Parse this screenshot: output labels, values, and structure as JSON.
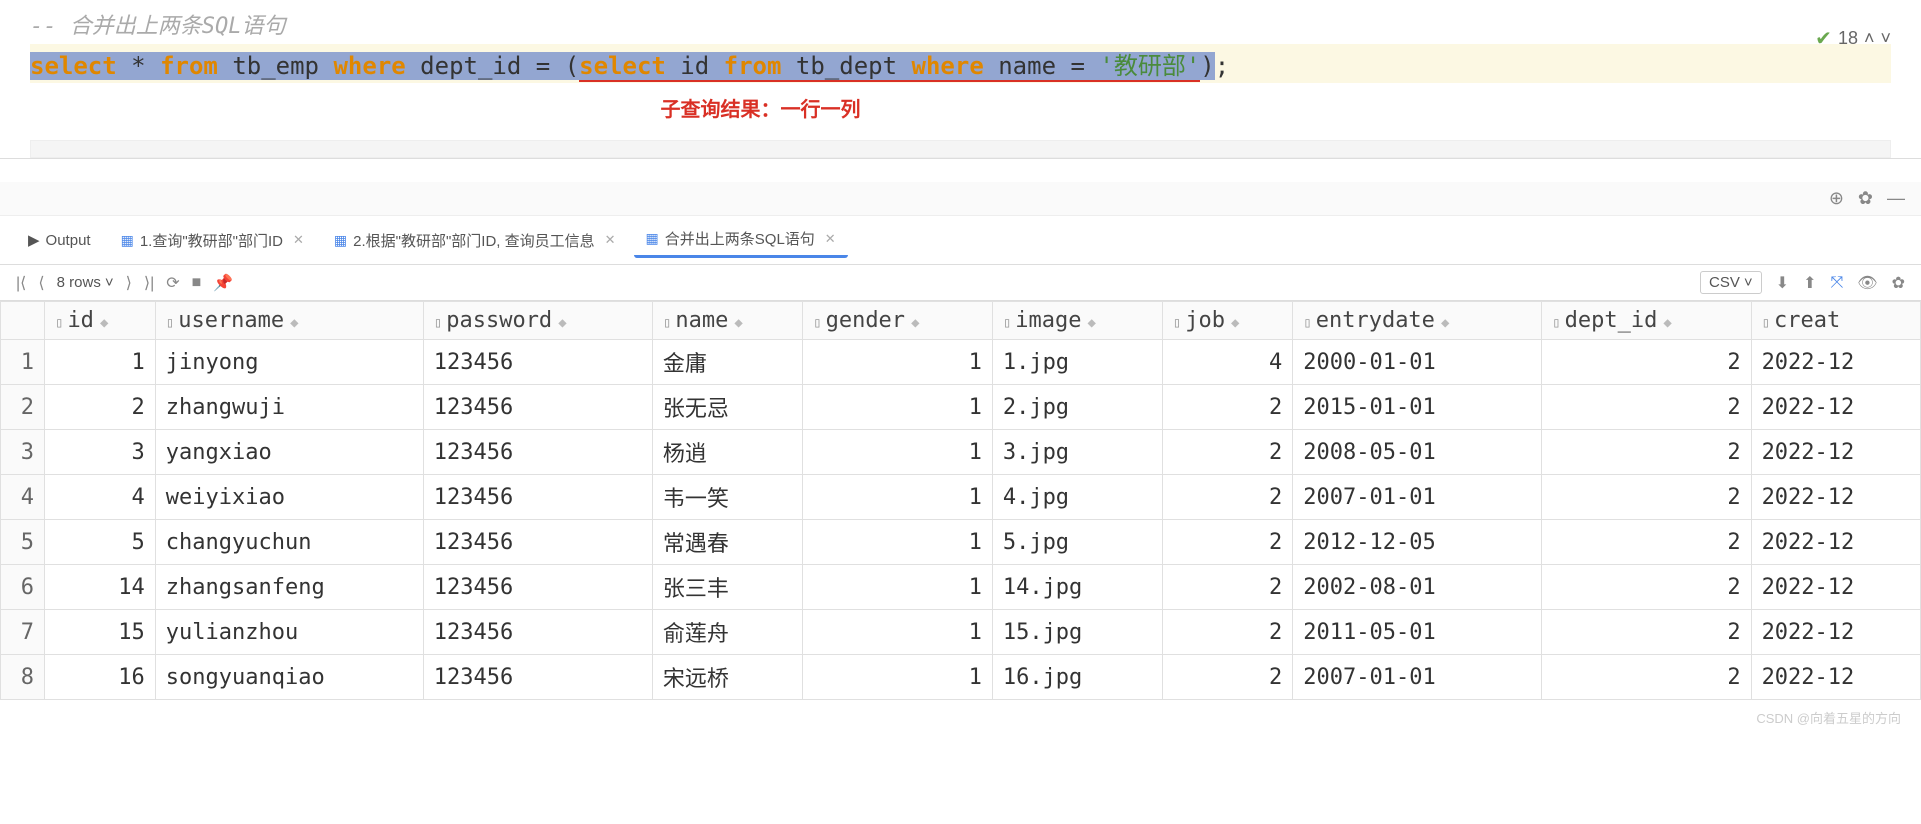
{
  "editor": {
    "comment_prefix": "-- ",
    "comment_text": "合并出上两条SQL语句",
    "sql_tokens": {
      "select": "select",
      "star": "*",
      "from": "from",
      "tb_emp": "tb_emp",
      "where": "where",
      "dept_id": "dept_id",
      "eq": " = ",
      "lp": "(",
      "id": "id",
      "tb_dept": "tb_dept",
      "name": "name",
      "strq": "'教研部'",
      "rp": ")",
      "semi": ";"
    },
    "annotation": "子查询结果：一行一列",
    "status_count": "18"
  },
  "tabs": {
    "output": "Output",
    "t1": "1.查询\"教研部\"部门ID",
    "t2": "2.根据\"教研部\"部门ID, 查询员工信息",
    "t3": "合并出上两条SQL语句"
  },
  "rows_label": "8 rows",
  "export_label": "CSV",
  "columns": [
    "id",
    "username",
    "password",
    "name",
    "gender",
    "image",
    "job",
    "entrydate",
    "dept_id",
    "creat"
  ],
  "chart_data": {
    "type": "table",
    "columns": [
      "id",
      "username",
      "password",
      "name",
      "gender",
      "image",
      "job",
      "entrydate",
      "dept_id",
      "create_time_prefix"
    ],
    "rows": [
      {
        "rn": "1",
        "id": "1",
        "username": "jinyong",
        "password": "123456",
        "name": "金庸",
        "gender": "1",
        "image": "1.jpg",
        "job": "4",
        "entrydate": "2000-01-01",
        "dept_id": "2",
        "ct": "2022-12"
      },
      {
        "rn": "2",
        "id": "2",
        "username": "zhangwuji",
        "password": "123456",
        "name": "张无忌",
        "gender": "1",
        "image": "2.jpg",
        "job": "2",
        "entrydate": "2015-01-01",
        "dept_id": "2",
        "ct": "2022-12"
      },
      {
        "rn": "3",
        "id": "3",
        "username": "yangxiao",
        "password": "123456",
        "name": "杨逍",
        "gender": "1",
        "image": "3.jpg",
        "job": "2",
        "entrydate": "2008-05-01",
        "dept_id": "2",
        "ct": "2022-12"
      },
      {
        "rn": "4",
        "id": "4",
        "username": "weiyixiao",
        "password": "123456",
        "name": "韦一笑",
        "gender": "1",
        "image": "4.jpg",
        "job": "2",
        "entrydate": "2007-01-01",
        "dept_id": "2",
        "ct": "2022-12"
      },
      {
        "rn": "5",
        "id": "5",
        "username": "changyuchun",
        "password": "123456",
        "name": "常遇春",
        "gender": "1",
        "image": "5.jpg",
        "job": "2",
        "entrydate": "2012-12-05",
        "dept_id": "2",
        "ct": "2022-12"
      },
      {
        "rn": "6",
        "id": "14",
        "username": "zhangsanfeng",
        "password": "123456",
        "name": "张三丰",
        "gender": "1",
        "image": "14.jpg",
        "job": "2",
        "entrydate": "2002-08-01",
        "dept_id": "2",
        "ct": "2022-12"
      },
      {
        "rn": "7",
        "id": "15",
        "username": "yulianzhou",
        "password": "123456",
        "name": "俞莲舟",
        "gender": "1",
        "image": "15.jpg",
        "job": "2",
        "entrydate": "2011-05-01",
        "dept_id": "2",
        "ct": "2022-12"
      },
      {
        "rn": "8",
        "id": "16",
        "username": "songyuanqiao",
        "password": "123456",
        "name": "宋远桥",
        "gender": "1",
        "image": "16.jpg",
        "job": "2",
        "entrydate": "2007-01-01",
        "dept_id": "2",
        "ct": "2022-12"
      }
    ]
  },
  "watermark": "CSDN @向着五星的方向"
}
